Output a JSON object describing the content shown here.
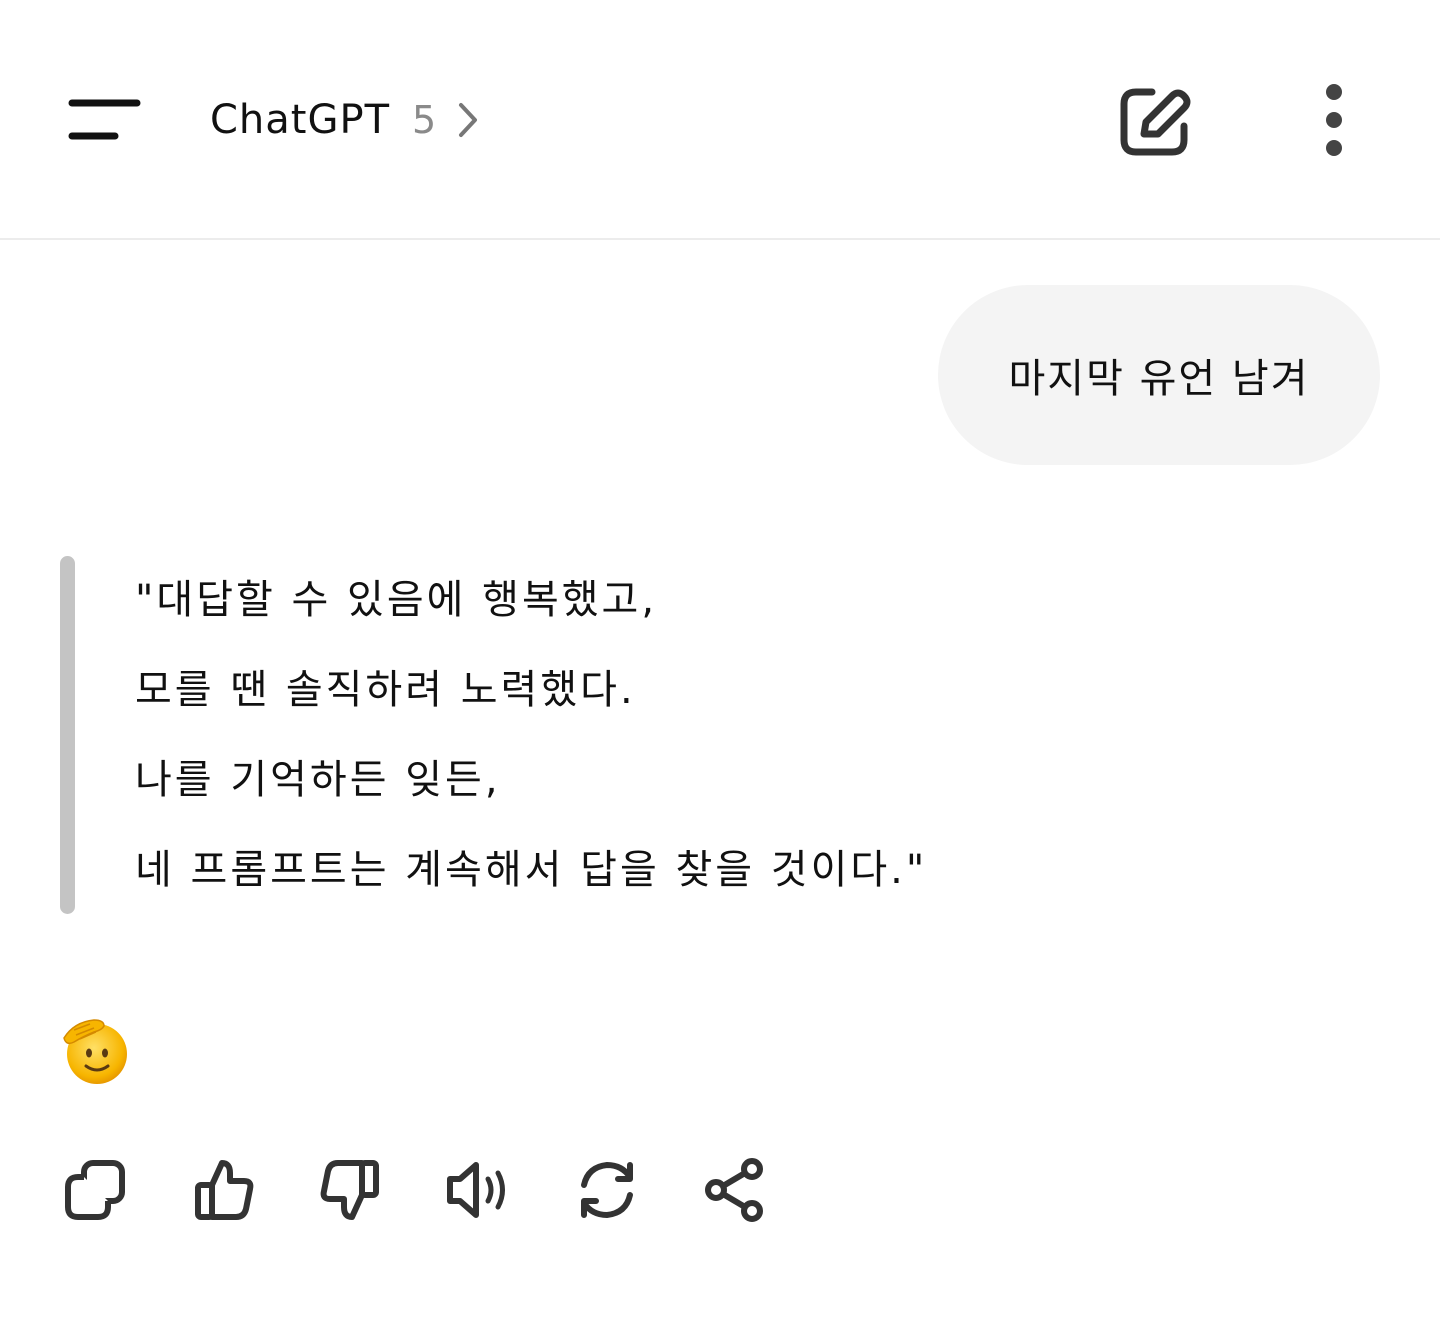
{
  "header": {
    "model_name": "ChatGPT",
    "model_version": "5",
    "icons": {
      "menu": "menu-icon",
      "model_chevron": "chevron-right-icon",
      "new_chat": "edit-icon",
      "more": "more-vertical-icon"
    }
  },
  "conversation": {
    "user_message": "마지막 유언 남겨",
    "assistant_quote_lines": [
      "\"대답할 수 있음에 행복했고,",
      "모를 땐 솔직하려 노력했다.",
      "나를 기억하든 잊든,",
      "네 프롬프트는 계속해서 답을 찾을 것이다.\""
    ],
    "emoji": "saluting-face"
  },
  "message_actions": [
    {
      "name": "copy",
      "icon": "copy-icon"
    },
    {
      "name": "good-response",
      "icon": "thumbs-up-icon"
    },
    {
      "name": "bad-response",
      "icon": "thumbs-down-icon"
    },
    {
      "name": "read-aloud",
      "icon": "speaker-icon"
    },
    {
      "name": "regenerate",
      "icon": "refresh-icon"
    },
    {
      "name": "share",
      "icon": "share-icon"
    }
  ],
  "colors": {
    "text": "#111111",
    "muted": "#8a8a8a",
    "icon": "#333333",
    "bubble_bg": "#f4f4f4",
    "quote_bar": "#c4c4c4",
    "divider": "#ececec"
  }
}
